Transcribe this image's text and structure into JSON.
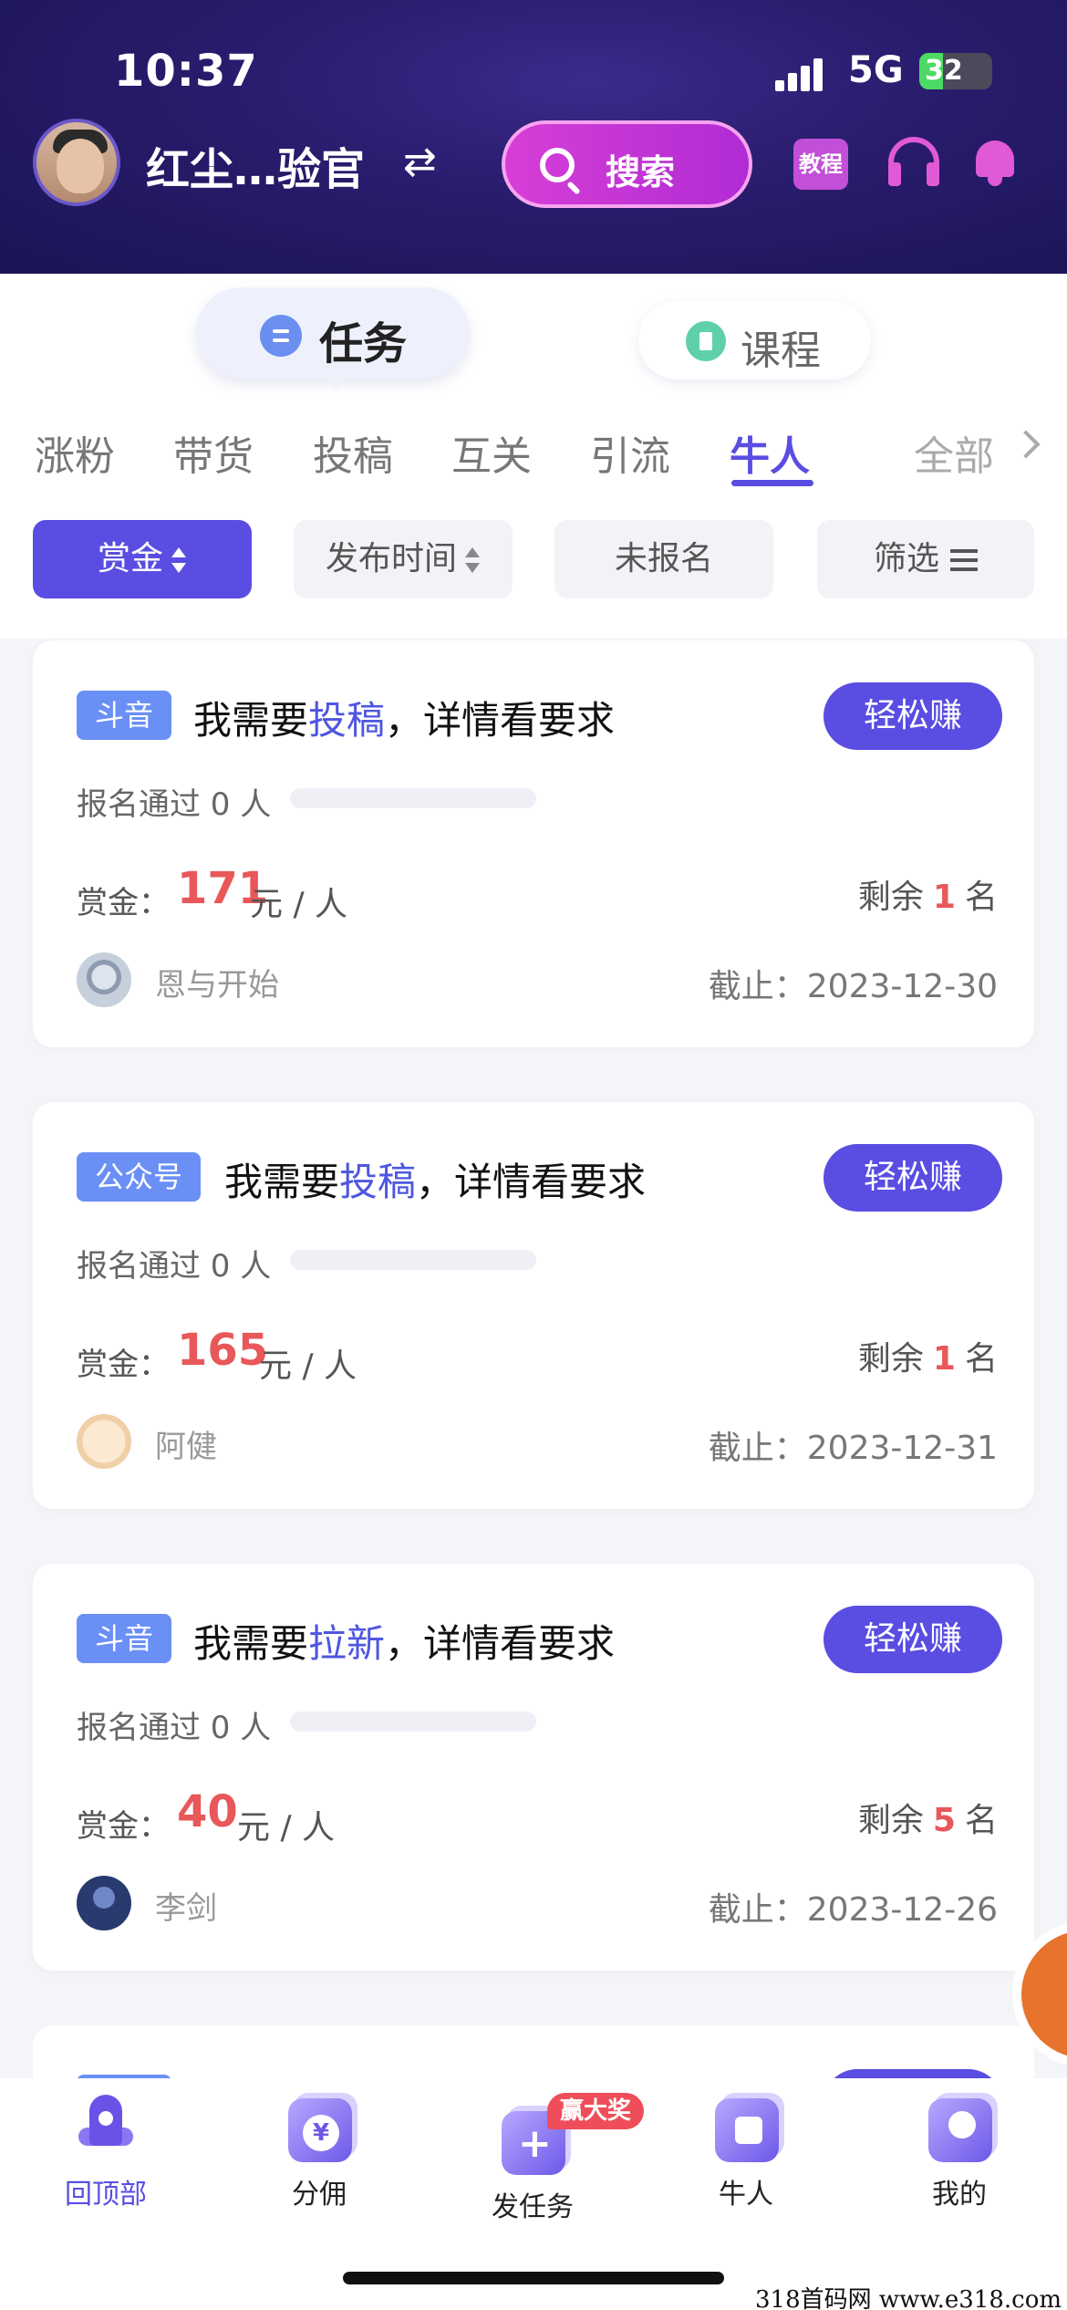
{
  "status_bar": {
    "time": "10:37",
    "network": "5G",
    "battery": "32",
    "battery_level": 0.32
  },
  "header": {
    "username": "红尘…验官",
    "swap_symbol": "⇄",
    "search_label": "搜索",
    "tutorial_label": "教程"
  },
  "segments": {
    "task": "任务",
    "course": "课程"
  },
  "categories": [
    "涨粉",
    "带货",
    "投稿",
    "互关",
    "引流",
    "牛人"
  ],
  "active_category": "牛人",
  "category_all": "全部",
  "filters": {
    "reward": "赏金",
    "publish_time": "发布时间",
    "unregistered": "未报名",
    "filter": "筛选"
  },
  "cards": [
    {
      "platform": "斗音",
      "title_prefix": "我需要",
      "title_highlight": "投稿",
      "title_suffix": "，详情看要求",
      "button": "轻松赚",
      "passed": "报名通过 0 人",
      "reward_label": "赏金：",
      "reward": "171",
      "reward_unit": "元 / 人",
      "remain_prefix": "剩余",
      "remain": "1",
      "remain_suffix": "名",
      "user": "恩与开始",
      "deadline_label": "截止：",
      "deadline": "2023-12-30"
    },
    {
      "platform": "公众号",
      "title_prefix": "我需要",
      "title_highlight": "投稿",
      "title_suffix": "，详情看要求",
      "button": "轻松赚",
      "passed": "报名通过 0 人",
      "reward_label": "赏金：",
      "reward": "165",
      "reward_unit": "元 / 人",
      "remain_prefix": "剩余",
      "remain": "1",
      "remain_suffix": "名",
      "user": "阿健",
      "deadline_label": "截止：",
      "deadline": "2023-12-31"
    },
    {
      "platform": "斗音",
      "title_prefix": "我需要",
      "title_highlight": "拉新",
      "title_suffix": "，详情看要求",
      "button": "轻松赚",
      "passed": "报名通过 0 人",
      "reward_label": "赏金：",
      "reward": "40",
      "reward_unit": "元 / 人",
      "remain_prefix": "剩余",
      "remain": "5",
      "remain_suffix": "名",
      "user": "李剑",
      "deadline_label": "截止：",
      "deadline": "2023-12-26"
    }
  ],
  "bottom_nav": {
    "top": "回顶部",
    "commission": "分佣",
    "publish": "发任务",
    "expert": "牛人",
    "mine": "我的",
    "prize_badge": "赢大奖"
  },
  "watermark": "318首码网  www.e318.com",
  "colors": {
    "accent": "#5a4de2",
    "reward": "#e8575a",
    "tag": "#6a8ff5",
    "header_bg": "#2a1c6e"
  }
}
